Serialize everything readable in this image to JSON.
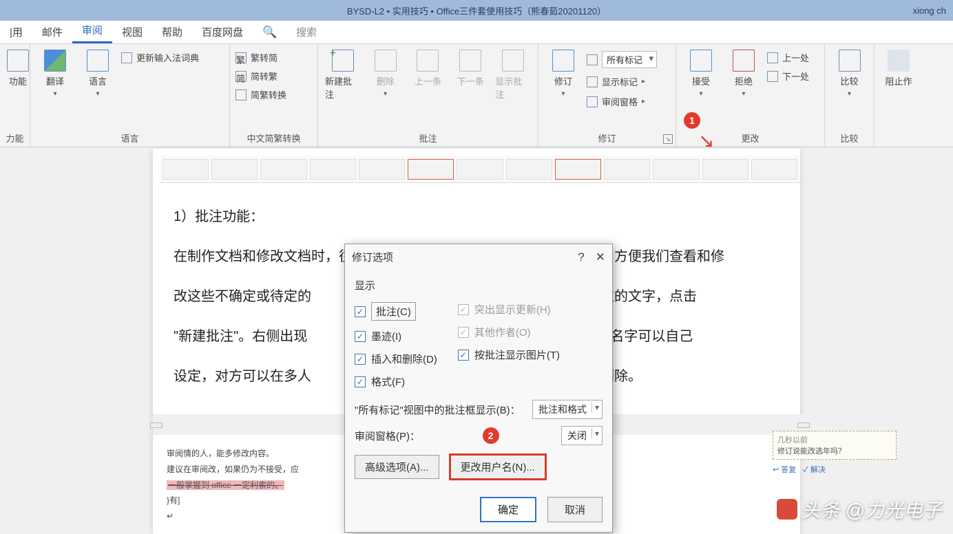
{
  "title_bar": {
    "doc_title": "BYSD-L2 • 实用技巧 • Office三件套使用技巧（熊春茹20201120）",
    "user": "xiong ch"
  },
  "tabs": {
    "t1": "|用",
    "t2": "邮件",
    "t3": "审阅",
    "t4": "视图",
    "t5": "帮助",
    "t6": "百度网盘",
    "search": "搜索"
  },
  "ribbon": {
    "acc": {
      "label": "功能",
      "sub": "力能"
    },
    "translate": "翻译",
    "language": "语言",
    "ime_dict": "更新输入法词典",
    "group_lang": "语言",
    "s2t": "繁转简",
    "t2s": "简转繁",
    "st_conv": "简繁转换",
    "group_conv": "中文简繁转换",
    "new_comment": "新建批注",
    "del_comment": "删除",
    "prev_comment": "上一条",
    "next_comment": "下一条",
    "show_comments": "显示批注",
    "group_comments": "批注",
    "track": "修订",
    "all_markup": "所有标记",
    "show_markup": "显示标记",
    "review_pane": "审阅窗格",
    "group_track": "修订",
    "accept": "接受",
    "reject": "拒绝",
    "prev_change": "上一处",
    "next_change": "下一处",
    "group_changes": "更改",
    "compare": "比较",
    "group_compare": "比较",
    "block": "阻止作"
  },
  "markers": {
    "m1": "1",
    "m2": "2"
  },
  "document": {
    "heading": "1）批注功能：",
    "p1": "在制作文档和修改文档时，往往会碰到一些不确定或者待定的内容。为了方便我们查看和修",
    "p2": "改这些不确定或待定的",
    "p2b": "和批注的文字，点击",
    "p3": "\"新建批注\"。右侧出现",
    "p3b": "批注，名字可以自己",
    "p4": "设定，对方可以在多人",
    "p4b": "批注删除。",
    "small1": "审阅情的人，能多修改内容。",
    "small2": "建议在审阅改，如果仍为不接受，应",
    "small_del": "一般掌握到 office 一定利索的。",
    "small3": "}有]",
    "comment_user": "几秒以前",
    "comment_text": "修订说能改选年吗？",
    "comment_reply": "答复",
    "comment_resolve": "解决"
  },
  "dialog": {
    "title": "修订选项",
    "section": "显示",
    "chk_comments": "批注(C)",
    "chk_ink": "墨迹(I)",
    "chk_insdel": "插入和删除(D)",
    "chk_format": "格式(F)",
    "chk_highlight": "突出显示更新(H)",
    "chk_others": "其他作者(O)",
    "chk_pictures": "按批注显示图片(T)",
    "balloons_label": "\"所有标记\"视图中的批注框显示(B)：",
    "balloons_value": "批注和格式",
    "pane_label": "审阅窗格(P)：",
    "pane_value": "关闭",
    "adv": "高级选项(A)...",
    "username": "更改用户名(N)...",
    "ok": "确定",
    "cancel": "取消"
  },
  "watermark": "头条 @力光电子"
}
